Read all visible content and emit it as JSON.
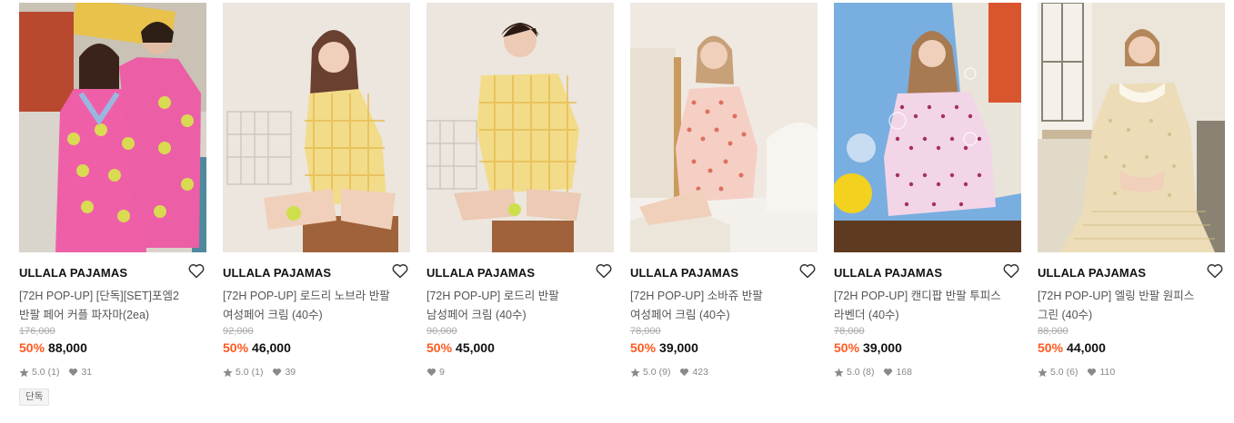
{
  "products": [
    {
      "brand": "ULLALA PAJAMAS",
      "name": "[72H POP-UP] [단독][SET]포엠2 반팔 페어 커플 파자마(2ea)",
      "original_price": "176,000",
      "discount": "50%",
      "price": "88,000",
      "rating": "5.0",
      "review_count": "(1)",
      "likes": "31",
      "tag": "단독",
      "image_alt": "couple in pink and green pattern short sleeve pajamas"
    },
    {
      "brand": "ULLALA PAJAMAS",
      "name": "[72H POP-UP] 로드리 노브라 반팔 여성페어 크림 (40수)",
      "original_price": "92,000",
      "discount": "50%",
      "price": "46,000",
      "rating": "5.0",
      "review_count": "(1)",
      "likes": "39",
      "image_alt": "woman in yellow check pajamas sitting on a box"
    },
    {
      "brand": "ULLALA PAJAMAS",
      "name": "[72H POP-UP] 로드리 반팔 남성페어 크림 (40수)",
      "original_price": "90,000",
      "discount": "50%",
      "price": "45,000",
      "likes": "9",
      "image_alt": "man in yellow check pajamas sitting on a box"
    },
    {
      "brand": "ULLALA PAJAMAS",
      "name": "[72H POP-UP] 소바쥬 반팔 여성페어 크림 (40수)",
      "original_price": "78,000",
      "discount": "50%",
      "price": "39,000",
      "rating": "5.0",
      "review_count": "(9)",
      "likes": "423",
      "image_alt": "woman in pink floral pajamas sitting on a bed"
    },
    {
      "brand": "ULLALA PAJAMAS",
      "name": "[72H POP-UP] 캔디팝 반팔 투피스 라벤더 (40수)",
      "original_price": "78,000",
      "discount": "50%",
      "price": "39,000",
      "rating": "5.0",
      "review_count": "(8)",
      "likes": "168",
      "image_alt": "girl in dotted lavender pajamas blowing bubbles"
    },
    {
      "brand": "ULLALA PAJAMAS",
      "name": "[72H POP-UP] 엘링 반팔 원피스 그린 (40수)",
      "original_price": "88,000",
      "discount": "50%",
      "price": "44,000",
      "rating": "5.0",
      "review_count": "(6)",
      "likes": "110",
      "image_alt": "woman in lace trim nightdress sitting by a window"
    }
  ],
  "colors": {
    "discount": "#ff5a1f",
    "brand_text": "#111111",
    "muted": "#888888",
    "strike": "#aaaaaa"
  },
  "icons": {
    "wishlist": "heart-outline-icon",
    "rating": "star-icon",
    "likes": "heart-filled-icon"
  }
}
